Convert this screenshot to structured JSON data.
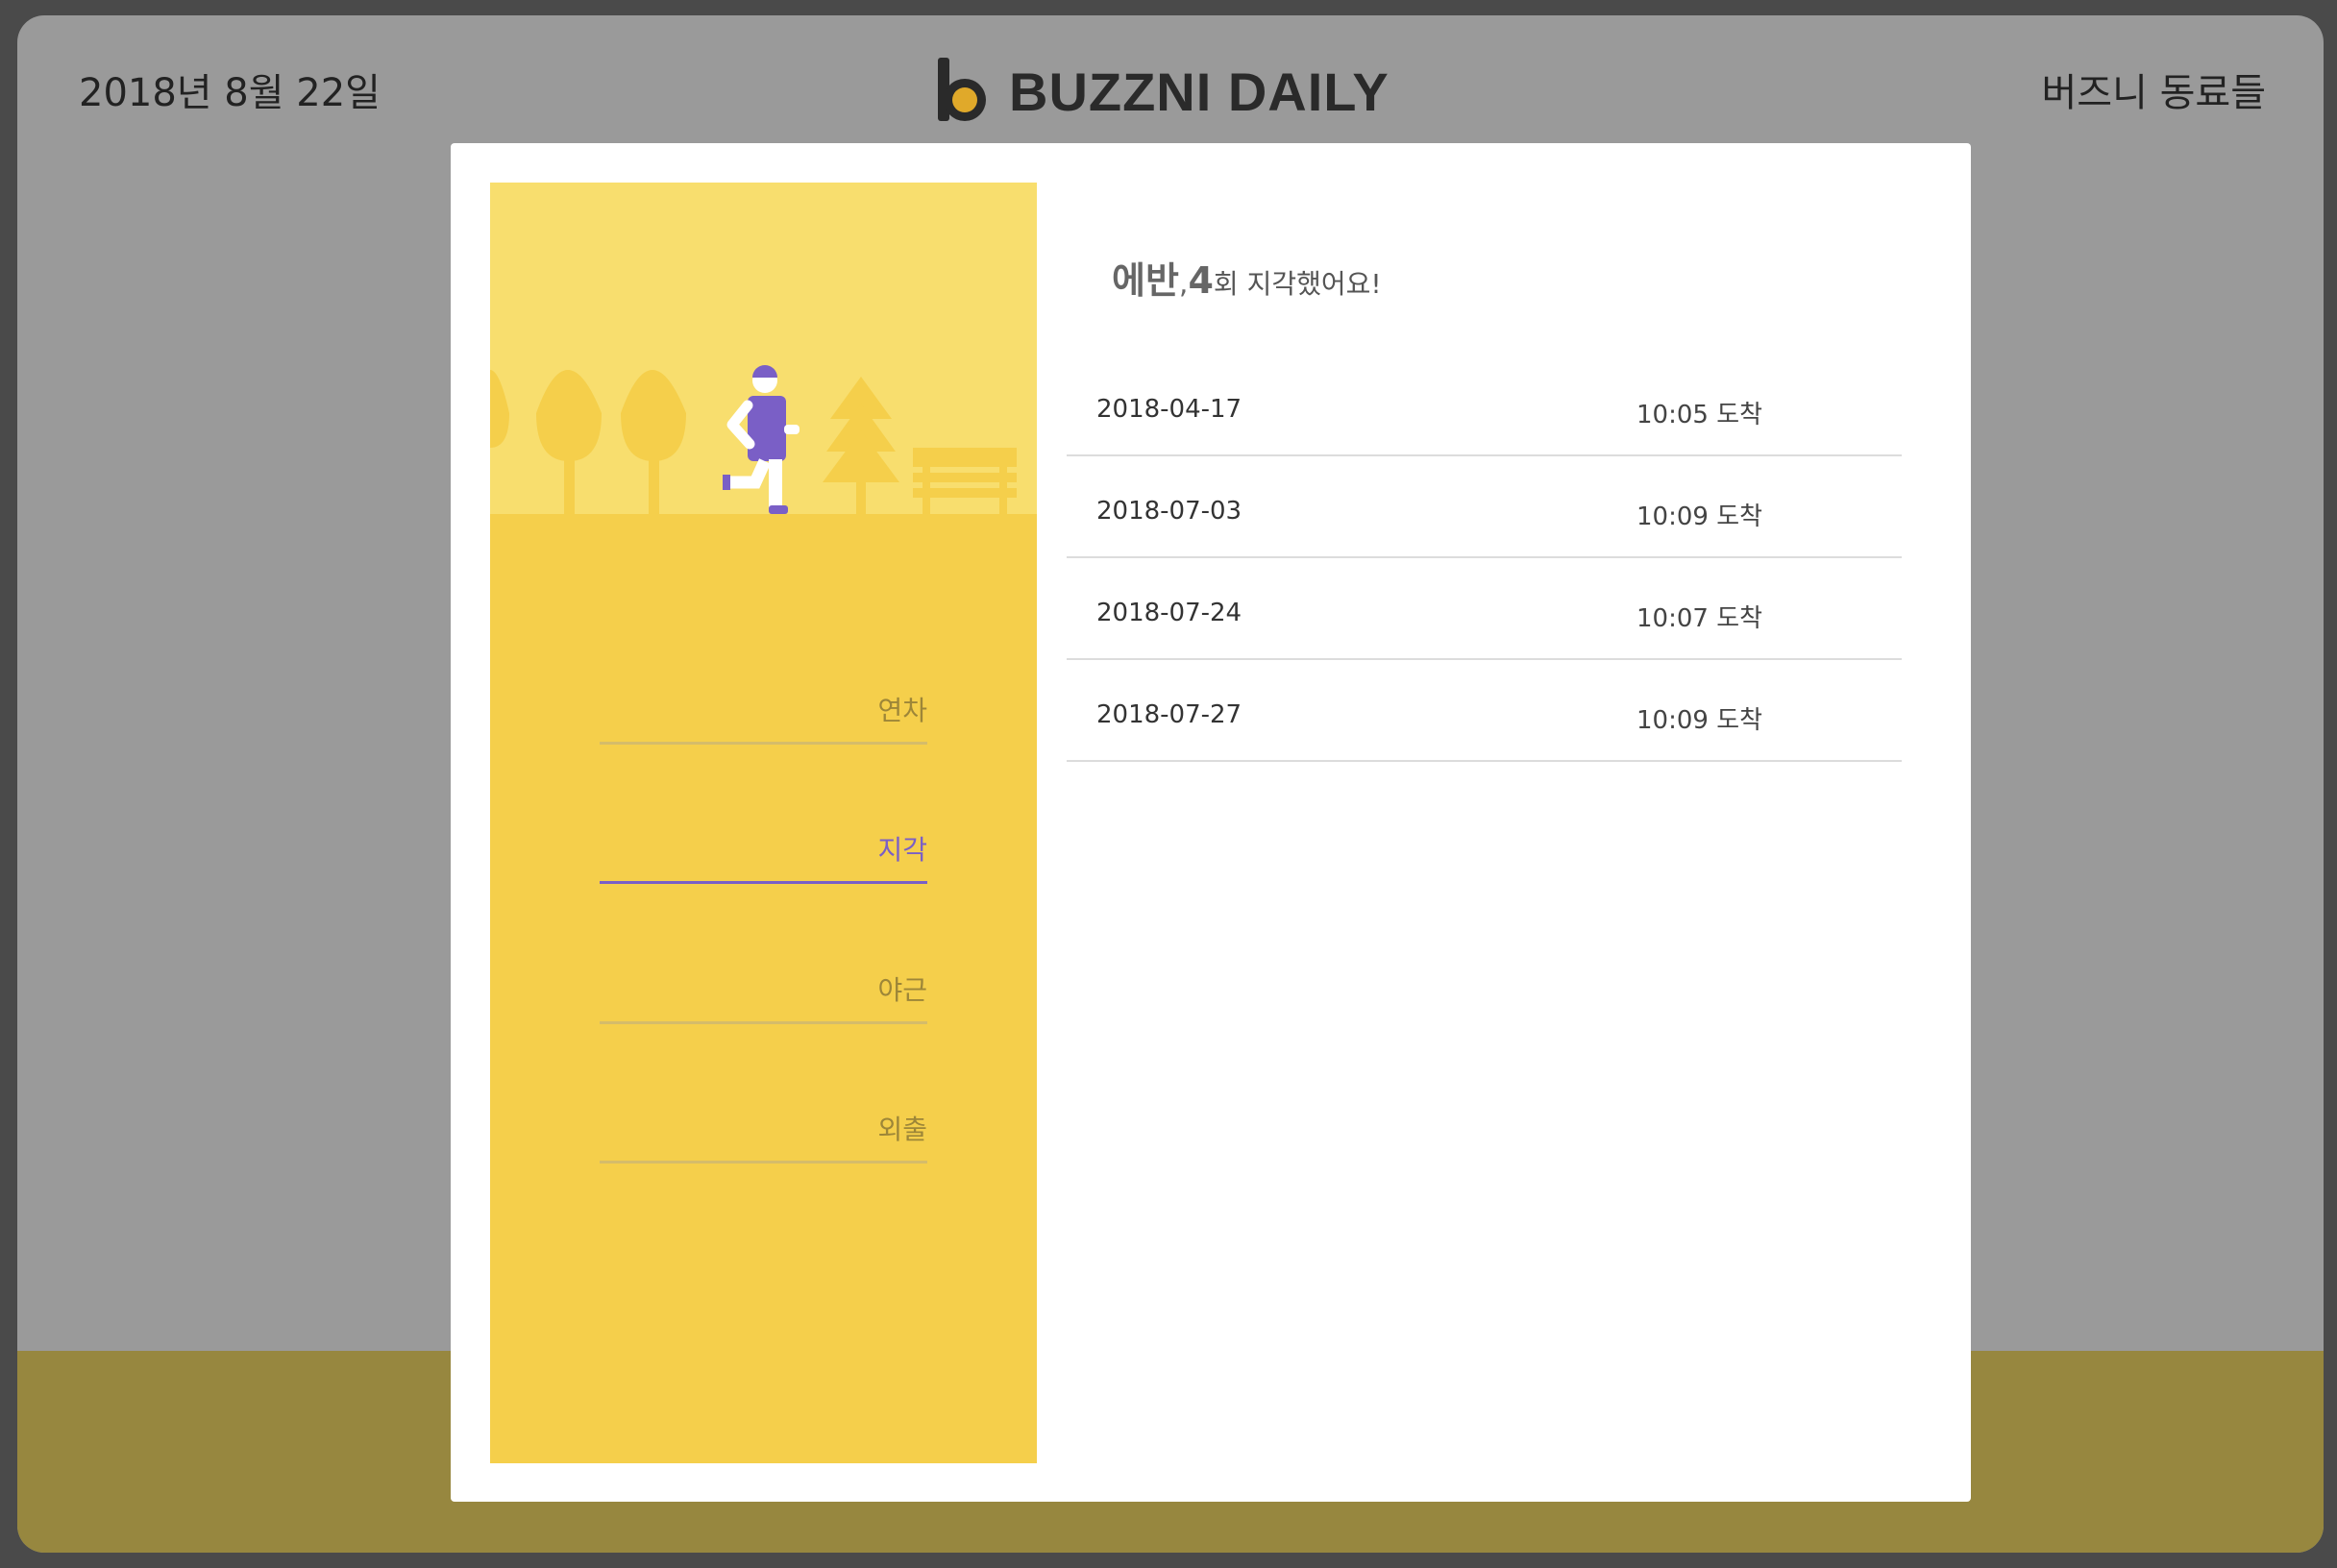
{
  "header": {
    "date": "2018년 8월 22일",
    "brand": "BUZZNI DAILY",
    "colleagues": "버즈니 동료들"
  },
  "sidebar": {
    "items": [
      {
        "label": "연차",
        "active": false
      },
      {
        "label": "지각",
        "active": true
      },
      {
        "label": "야근",
        "active": false
      },
      {
        "label": "외출",
        "active": false
      }
    ]
  },
  "detail": {
    "name": "에반",
    "comma": ",",
    "count": "4",
    "suffix": "회 지각했어요!",
    "records": [
      {
        "date": "2018-04-17",
        "time": "10:05 도착"
      },
      {
        "date": "2018-07-03",
        "time": "10:09 도착"
      },
      {
        "date": "2018-07-24",
        "time": "10:07 도착"
      },
      {
        "date": "2018-07-27",
        "time": "10:09 도착"
      }
    ]
  },
  "colors": {
    "accent": "#7a5fc6",
    "panel": "#f5cf4b",
    "sky": "#f8de6e",
    "backdrop_band": "#97873f"
  }
}
